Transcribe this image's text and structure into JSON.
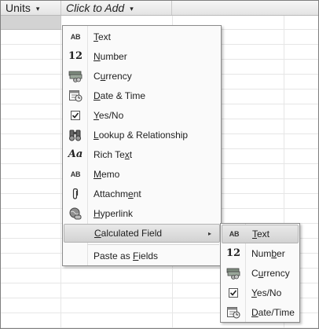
{
  "datasheet": {
    "columns": [
      {
        "label": "Units",
        "dropdown": "▾"
      },
      {
        "label": "Click to Add",
        "dropdown": "▾"
      }
    ]
  },
  "main_menu": {
    "items": [
      {
        "icon": "text-icon",
        "glyph": "AB",
        "label": "Text"
      },
      {
        "icon": "number-icon",
        "glyph": "12",
        "label": "Number"
      },
      {
        "icon": "currency-icon",
        "label": "Currency"
      },
      {
        "icon": "date-time-icon",
        "label": "Date & Time"
      },
      {
        "icon": "yes-no-icon",
        "label": "Yes/No"
      },
      {
        "icon": "lookup-icon",
        "label": "Lookup & Relationship"
      },
      {
        "icon": "rich-text-icon",
        "glyph": "Aa",
        "label": "Rich Text"
      },
      {
        "icon": "memo-icon",
        "glyph": "AB",
        "label": "Memo"
      },
      {
        "icon": "attachment-icon",
        "label": "Attachment"
      },
      {
        "icon": "hyperlink-icon",
        "label": "Hyperlink"
      },
      {
        "label": "Calculated Field",
        "submenu_arrow": "▸",
        "highlighted": true
      },
      {
        "label": "Paste as Fields"
      }
    ]
  },
  "sub_menu": {
    "items": [
      {
        "icon": "text-icon",
        "glyph": "AB",
        "label": "Text",
        "highlighted": true
      },
      {
        "icon": "number-icon",
        "glyph": "12",
        "label": "Number"
      },
      {
        "icon": "currency-icon",
        "label": "Currency"
      },
      {
        "icon": "yes-no-icon",
        "label": "Yes/No"
      },
      {
        "icon": "date-time-icon",
        "label": "Date/Time"
      }
    ]
  }
}
